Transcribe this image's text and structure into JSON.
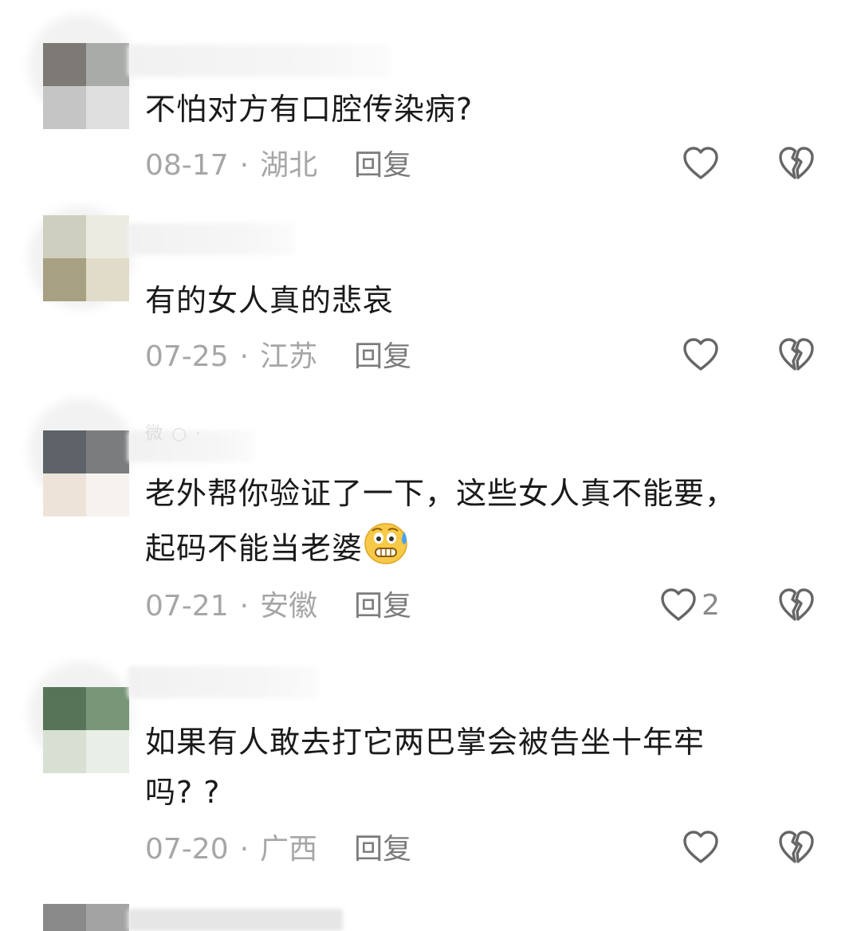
{
  "comments": [
    {
      "text": "不怕对方有口腔传染病?",
      "date": "08-17",
      "separator": "·",
      "location": "湖北",
      "reply_label": "回复",
      "like_count": ""
    },
    {
      "text": "有的女人真的悲哀",
      "date": "07-25",
      "separator": "·",
      "location": "江苏",
      "reply_label": "回复",
      "like_count": ""
    },
    {
      "username": "微 ○ ·",
      "text_line1": "老外帮你验证了一下，这些女人真不能要，",
      "text_line2": "起码不能当老婆",
      "emoji": "anxious-sweat-face-emoji",
      "date": "07-21",
      "separator": "·",
      "location": "安徽",
      "reply_label": "回复",
      "like_count": "2"
    },
    {
      "text_line1": "如果有人敢去打它两巴掌会被告坐十年牢",
      "text_line2": "吗? ?",
      "date": "07-20",
      "separator": "·",
      "location": "广西",
      "reply_label": "回复",
      "like_count": ""
    }
  ],
  "icons": {
    "like": "heart-outline-icon",
    "dislike": "broken-heart-outline-icon"
  },
  "colors": {
    "text": "#1a1a1a",
    "meta": "#a6a6a6",
    "reply": "#7c7c7c",
    "icon": "#666666"
  }
}
